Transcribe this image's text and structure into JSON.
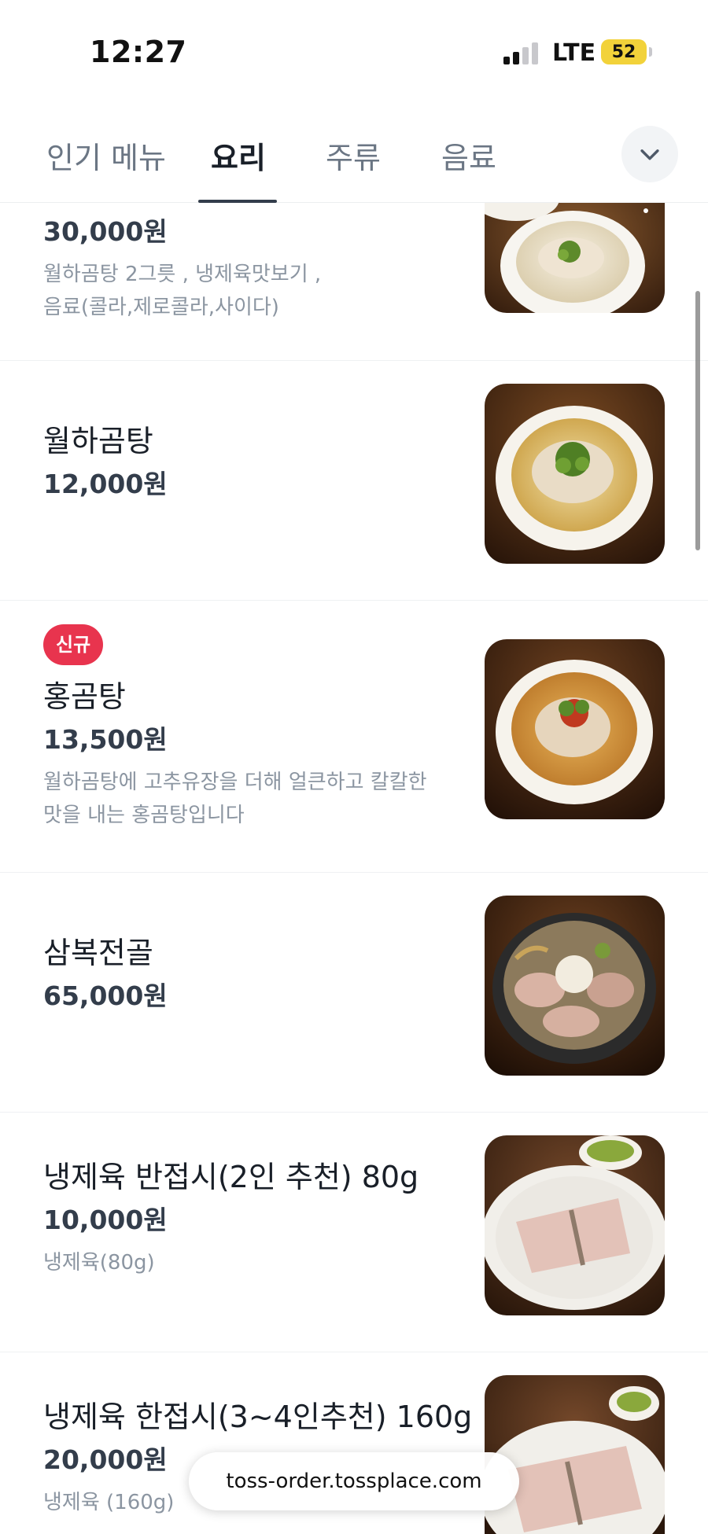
{
  "status_bar": {
    "time": "12:27",
    "network": "LTE",
    "battery": "52"
  },
  "tabs": [
    {
      "label": "인기 메뉴",
      "active": false
    },
    {
      "label": "요리",
      "active": true
    },
    {
      "label": "주류",
      "active": false
    },
    {
      "label": "음료",
      "active": false
    }
  ],
  "menu_items": [
    {
      "name": "",
      "price": "30,000원",
      "description": [
        "월하곰탕 2그릇 , 냉제육맛보기 ,",
        "음료(콜라,제로콜라,사이다)"
      ],
      "photo": "gomtang-set-photo"
    },
    {
      "name": "월하곰탕",
      "price": "12,000원",
      "photo": "gomtang-photo"
    },
    {
      "badge": "신규",
      "name": "홍곰탕",
      "price": "13,500원",
      "description": [
        "월하곰탕에 고추유장을 더해 얼큰하고 칼칼한",
        "맛을 내는 홍곰탕입니다"
      ],
      "photo": "hong-gomtang-photo"
    },
    {
      "name": "삼복전골",
      "price": "65,000원",
      "photo": "sambok-jeongol-photo"
    },
    {
      "name": "냉제육 반접시(2인 추천) 80g",
      "price": "10,000원",
      "description": [
        "냉제육(80g)"
      ],
      "photo": "naengjeyuk-half-photo"
    },
    {
      "name": "냉제육 한접시(3~4인추천) 160g",
      "price": "20,000원",
      "description": [
        "냉제육 (160g)"
      ],
      "photo": "naengjeyuk-full-photo"
    }
  ],
  "url_bar": {
    "url": "toss-order.tossplace.com"
  },
  "colors": {
    "badge": "#e8344e",
    "battery": "#f2d23a",
    "active_tab": "#191f28",
    "inactive_tab": "#6b7684"
  }
}
